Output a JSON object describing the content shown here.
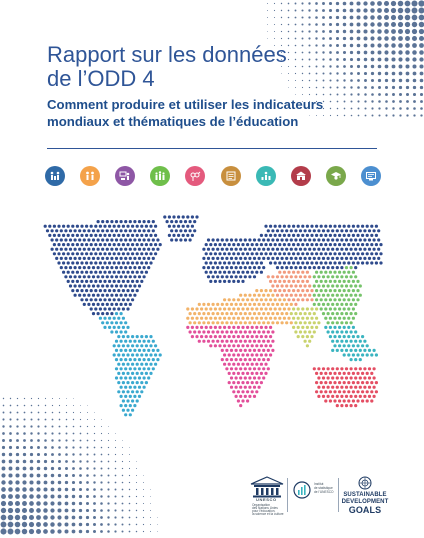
{
  "cover": {
    "title_lines": [
      "Rapport sur les données",
      "de l’ODD 4"
    ],
    "subtitle_lines": [
      "Comment produire et utiliser les indicateurs",
      "mondiaux et thématiques de l’éducation"
    ]
  },
  "colors": {
    "title": "#2f5597",
    "subtitle": "#1f4e8c",
    "halftone": "#5b7396",
    "map_base": "#2e4a8c",
    "north_africa_middle_east": "#f2b36a",
    "russia_central_asia": "#f29a7e",
    "east_asia": "#76c36b",
    "south_asia": "#c9d36e",
    "southeast_asia": "#3ab4c0",
    "sub_saharan_africa": "#e24f9a",
    "latin_america": "#3aa9cf",
    "oceania": "#e44e63"
  },
  "icons": [
    {
      "name": "family-icon",
      "color": "#2f6aa7"
    },
    {
      "name": "people-icon",
      "color": "#f4a24a"
    },
    {
      "name": "teacher-icon",
      "color": "#8e57a5"
    },
    {
      "name": "group-icon",
      "color": "#6fbf4b"
    },
    {
      "name": "gender-icon",
      "color": "#e45a7d"
    },
    {
      "name": "book-icon",
      "color": "#c88f3e"
    },
    {
      "name": "skills-icon",
      "color": "#3ab9b5"
    },
    {
      "name": "school-icon",
      "color": "#b33c4a"
    },
    {
      "name": "graduate-icon",
      "color": "#7aa84b"
    },
    {
      "name": "scholarship-icon",
      "color": "#4c8fd0"
    }
  ],
  "logos": {
    "unesco_wordmark": "UNESCO",
    "unesco_org_lines": [
      "Organisation",
      "des Nations Unies",
      "pour l’éducation,",
      "la science et la culture"
    ],
    "uis_lines": [
      "Institut",
      "de statistique",
      "de l’UNESCO"
    ],
    "sdg_lines": [
      "SUSTAINABLE",
      "DEVELOPMENT",
      "GOALS"
    ]
  }
}
